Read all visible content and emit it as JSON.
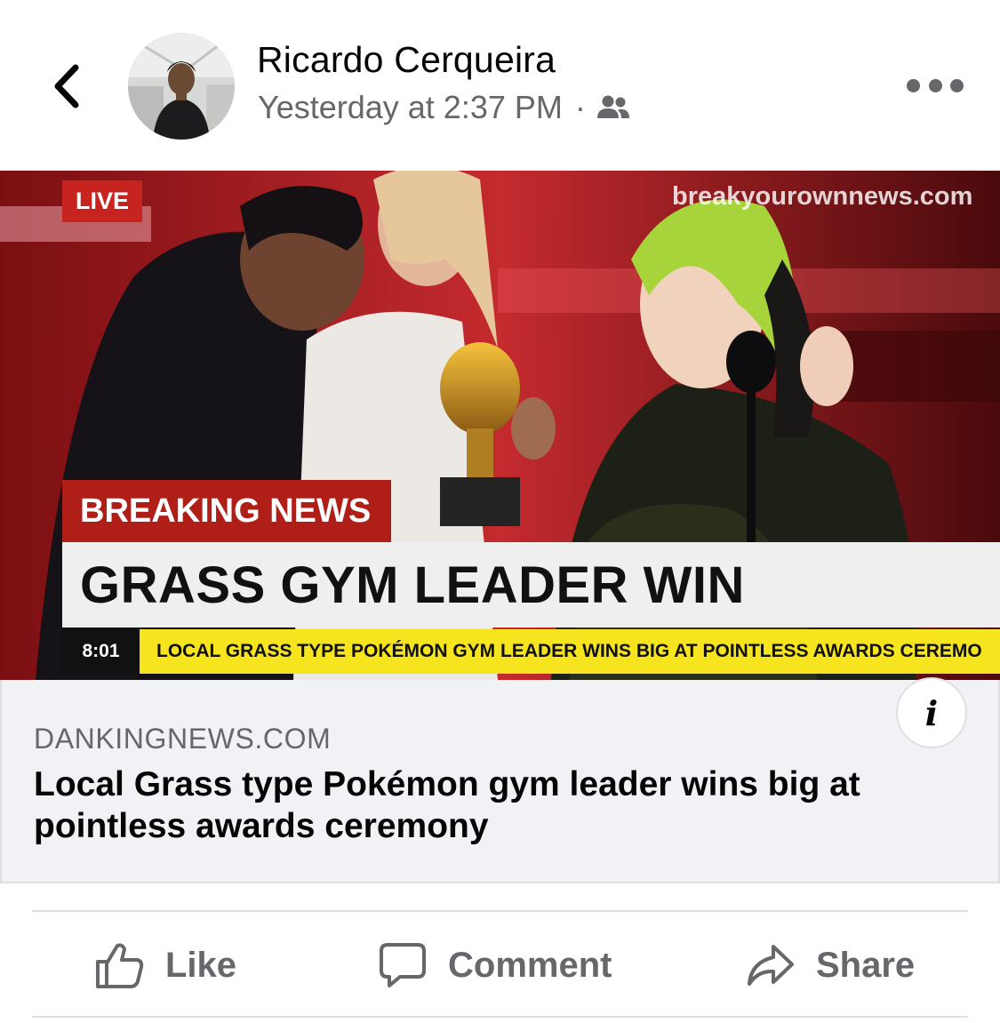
{
  "post": {
    "author": "Ricardo Cerqueira",
    "timestamp": "Yesterday at 2:37 PM",
    "separator": "·",
    "audience_icon": "friends-icon",
    "back_icon": "chevron-left-icon",
    "more_icon": "more-horizontal-icon"
  },
  "media": {
    "live_label": "LIVE",
    "watermark": "breakyourownnews.com",
    "breaking_label": "BREAKING NEWS",
    "headline": "GRASS GYM LEADER WIN",
    "time": "8:01",
    "ticker": "LOCAL GRASS TYPE POKÉMON GYM LEADER WINS BIG AT POINTLESS AWARDS CEREMO"
  },
  "link": {
    "domain": "DANKINGNEWS.COM",
    "title": "Local Grass type Pokémon gym leader wins big at pointless awards ceremony",
    "info_icon": "info-icon"
  },
  "actions": {
    "like_label": "Like",
    "comment_label": "Comment",
    "share_label": "Share"
  },
  "colors": {
    "text_primary": "#050505",
    "text_secondary": "#65676b",
    "card_bg": "#f0f2f5",
    "divider": "#dddfe2",
    "breaking_red": "#b01e18",
    "ticker_yellow": "#f6e51e"
  }
}
